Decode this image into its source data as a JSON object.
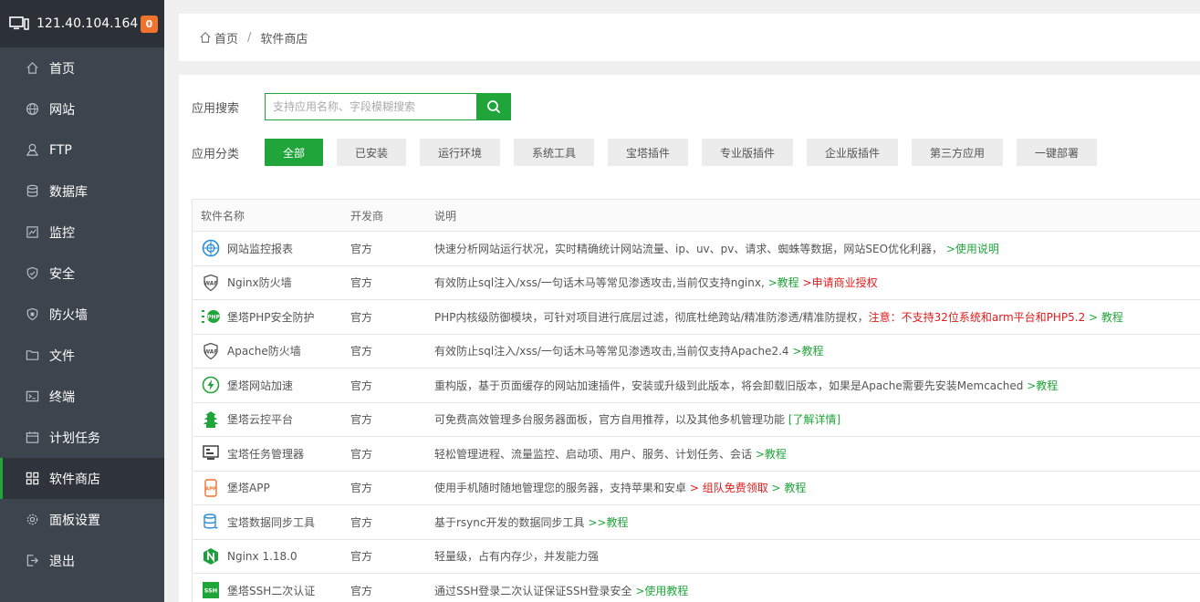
{
  "sidebar": {
    "server_ip": "121.40.104.164",
    "badge_count": "0",
    "items": [
      {
        "label": "首页",
        "icon": "home-icon"
      },
      {
        "label": "网站",
        "icon": "globe-icon"
      },
      {
        "label": "FTP",
        "icon": "ftp-icon"
      },
      {
        "label": "数据库",
        "icon": "database-icon"
      },
      {
        "label": "监控",
        "icon": "monitor-icon"
      },
      {
        "label": "安全",
        "icon": "shield-icon"
      },
      {
        "label": "防火墙",
        "icon": "firewall-icon"
      },
      {
        "label": "文件",
        "icon": "folder-icon"
      },
      {
        "label": "终端",
        "icon": "terminal-icon"
      },
      {
        "label": "计划任务",
        "icon": "calendar-icon"
      },
      {
        "label": "软件商店",
        "icon": "apps-grid-icon"
      },
      {
        "label": "面板设置",
        "icon": "gear-icon"
      },
      {
        "label": "退出",
        "icon": "logout-icon"
      }
    ]
  },
  "breadcrumb": {
    "home": "首页",
    "current": "软件商店"
  },
  "search": {
    "label": "应用搜索",
    "placeholder": "支持应用名称、字段模糊搜索"
  },
  "category": {
    "label": "应用分类",
    "items": [
      "全部",
      "已安装",
      "运行环境",
      "系统工具",
      "宝塔插件",
      "专业版插件",
      "企业版插件",
      "第三方应用",
      "一键部署"
    ]
  },
  "table": {
    "headers": [
      "软件名称",
      "开发商",
      "说明"
    ],
    "rows": [
      {
        "name": "网站监控报表",
        "dev": "官方",
        "desc": "快速分析网站运行状况，实时精确统计网站流量、ip、uv、pv、请求、蜘蛛等数据，网站SEO优化利器，",
        "link1": ">使用说明",
        "warn": "",
        "link2": ""
      },
      {
        "name": "Nginx防火墙",
        "dev": "官方",
        "desc": "有效防止sql注入/xss/一句话木马等常见渗透攻击,当前仅支持nginx,",
        "link1": ">教程",
        "warn": ">申请商业授权",
        "link2": ""
      },
      {
        "name": "堡塔PHP安全防护",
        "dev": "官方",
        "desc": "PHP内核级防御模块，可针对项目进行底层过滤，彻底杜绝跨站/精准防渗透/精准防提权，",
        "link1": "",
        "warn": "注意：不支持32位系统和arm平台和PHP5.2",
        "link2": "> 教程"
      },
      {
        "name": "Apache防火墙",
        "dev": "官方",
        "desc": "有效防止sql注入/xss/一句话木马等常见渗透攻击,当前仅支持Apache2.4",
        "link1": ">教程",
        "warn": "",
        "link2": ""
      },
      {
        "name": "堡塔网站加速",
        "dev": "官方",
        "desc": "重构版，基于页面缓存的网站加速插件，安装或升级到此版本，将会卸载旧版本，如果是Apache需要先安装Memcached",
        "link1": ">教程",
        "warn": "",
        "link2": ""
      },
      {
        "name": "堡塔云控平台",
        "dev": "官方",
        "desc": "可免费高效管理多台服务器面板，官方自用推荐，以及其他多机管理功能",
        "link1": "[了解详情]",
        "warn": "",
        "link2": ""
      },
      {
        "name": "宝塔任务管理器",
        "dev": "官方",
        "desc": "轻松管理进程、流量监控、启动项、用户、服务、计划任务、会话",
        "link1": ">教程",
        "warn": "",
        "link2": ""
      },
      {
        "name": "堡塔APP",
        "dev": "官方",
        "desc": "使用手机随时随地管理您的服务器，支持苹果和安卓",
        "link1": "",
        "warn": "> 组队免费领取",
        "link2": "> 教程"
      },
      {
        "name": "宝塔数据同步工具",
        "dev": "官方",
        "desc": "基于rsync开发的数据同步工具",
        "link1": ">>教程",
        "warn": "",
        "link2": ""
      },
      {
        "name": "Nginx 1.18.0",
        "dev": "官方",
        "desc": "轻量级，占有内存少，并发能力强",
        "link1": "",
        "warn": "",
        "link2": ""
      },
      {
        "name": "堡塔SSH二次认证",
        "dev": "官方",
        "desc": "通过SSH登录二次认证保证SSH登录安全",
        "link1": ">使用教程",
        "warn": "",
        "link2": ""
      }
    ]
  },
  "colors": {
    "accent": "#20a53a",
    "sidebar": "#3c444d",
    "badge": "#f0732d",
    "warn": "#e01b1b"
  }
}
